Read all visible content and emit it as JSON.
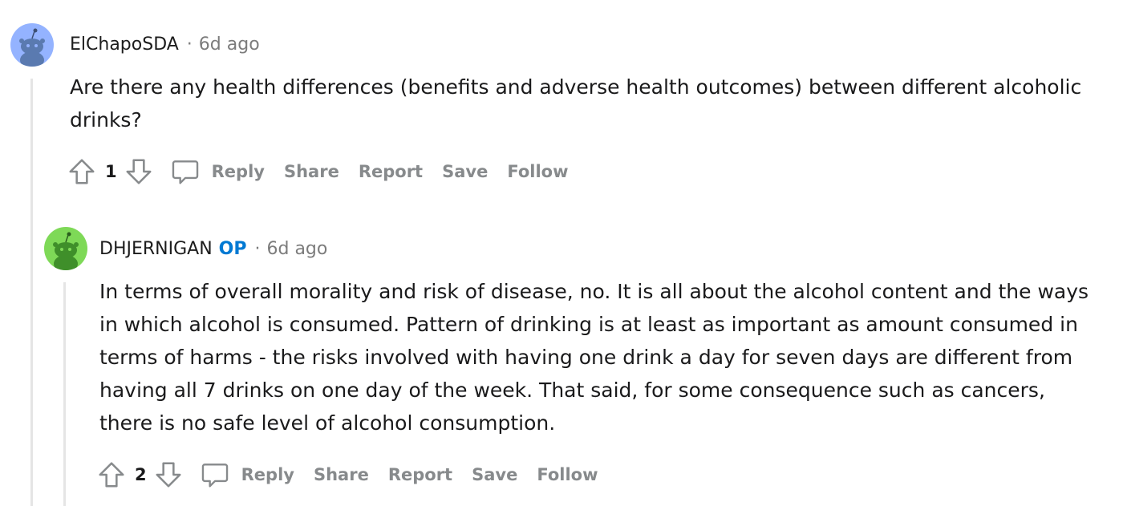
{
  "comments": [
    {
      "username": "ElChapoSDA",
      "op_badge": "",
      "separator": "·",
      "time": "6d ago",
      "avatar_color": "#94b3ff",
      "body": "Are there any health differences (benefits and adverse health outcomes) between different alcoholic drinks?",
      "score": "1",
      "actions": {
        "reply": "Reply",
        "share": "Share",
        "report": "Report",
        "save": "Save",
        "follow": "Follow"
      }
    },
    {
      "username": "DHJERNIGAN",
      "op_badge": "OP",
      "separator": "·",
      "time": "6d ago",
      "avatar_color": "#7ed957",
      "body": "In terms of overall morality and risk of disease, no. It is all about the alcohol content and the ways in which alcohol is consumed. Pattern of drinking is at least as important as amount consumed in terms of harms - the risks involved with having one drink a day for seven days are different from having all 7 drinks on one day of the week. That said, for some consequence such as cancers, there is no safe level of alcohol consumption.",
      "score": "2",
      "actions": {
        "reply": "Reply",
        "share": "Share",
        "report": "Report",
        "save": "Save",
        "follow": "Follow"
      }
    }
  ],
  "colors": {
    "op": "#0079d3",
    "muted": "#878a8c",
    "thread_line": "#e5e5e5"
  }
}
